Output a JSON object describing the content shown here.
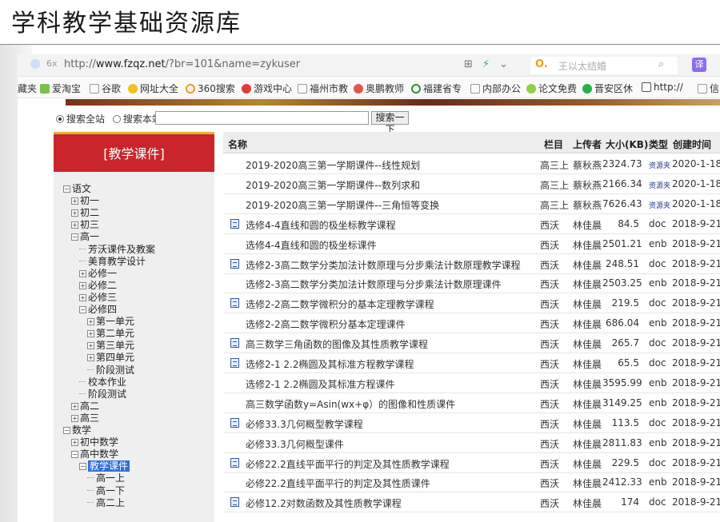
{
  "slide_title": "学科教学基础资源库",
  "browser": {
    "url_prefix": "http://",
    "url_host": "www.fzqz.net",
    "url_path": "/?br=101&name=zykuser",
    "search_placeholder": "王以太结婚",
    "search_engine_glyph": "O.",
    "translate_label": "译",
    "bookmarks": [
      "藏夹",
      "爱淘宝",
      "谷歌",
      "网址大全",
      "360搜索",
      "游戏中心",
      "福州市教",
      "奥鹏教师",
      "福建省专",
      "内部办公",
      "论文免费",
      "晋安区休",
      "http://",
      "信"
    ]
  },
  "site_search": {
    "option_all": "搜索全站",
    "option_site": "搜索本站",
    "button": "搜索一下"
  },
  "sidebar": {
    "header": "[教学课件]",
    "tree": [
      {
        "label": "语文",
        "toggle": "⊟"
      },
      {
        "label": "初一",
        "toggle": "⊞"
      },
      {
        "label": "初二",
        "toggle": "⊞"
      },
      {
        "label": "初三",
        "toggle": "⊞"
      },
      {
        "label": "高一",
        "toggle": "⊟"
      },
      {
        "label": "芳沃课件及教案",
        "toggle": ""
      },
      {
        "label": "美育教学设计",
        "toggle": ""
      },
      {
        "label": "必修一",
        "toggle": "⊞"
      },
      {
        "label": "必修二",
        "toggle": "⊞"
      },
      {
        "label": "必修三",
        "toggle": "⊞"
      },
      {
        "label": "必修四",
        "toggle": "⊟"
      },
      {
        "label": "第一单元",
        "toggle": "⊞"
      },
      {
        "label": "第二单元",
        "toggle": "⊞"
      },
      {
        "label": "第三单元",
        "toggle": "⊞"
      },
      {
        "label": "第四单元",
        "toggle": "⊞"
      },
      {
        "label": "阶段测试",
        "toggle": ""
      },
      {
        "label": "校本作业",
        "toggle": ""
      },
      {
        "label": "阶段测试",
        "toggle": ""
      },
      {
        "label": "高二",
        "toggle": "⊞"
      },
      {
        "label": "高三",
        "toggle": "⊞"
      },
      {
        "label": "数学",
        "toggle": "⊟"
      },
      {
        "label": "初中数学",
        "toggle": "⊞"
      },
      {
        "label": "高中数学",
        "toggle": "⊟"
      },
      {
        "label": "教学课件",
        "toggle": "⊟"
      },
      {
        "label": "高一上",
        "toggle": ""
      },
      {
        "label": "高一下",
        "toggle": ""
      },
      {
        "label": "高二上",
        "toggle": ""
      }
    ]
  },
  "table": {
    "headers": [
      "名称",
      "栏目",
      "上传者",
      "大小(KB)",
      "类型",
      "创建时间"
    ],
    "rows": [
      {
        "name": "2019-2020高三第一学期课件--线性规划",
        "col": "高三上",
        "up": "蔡秋燕",
        "size": "2324.73",
        "type": "资源夹",
        "date": "2020-1-18",
        "icon": false
      },
      {
        "name": "2019-2020高三第一学期课件--数列求和",
        "col": "高三上",
        "up": "蔡秋燕",
        "size": "2166.34",
        "type": "资源夹",
        "date": "2020-1-18",
        "icon": false
      },
      {
        "name": "2019-2020高三第一学期课件--三角恒等变换",
        "col": "高三上",
        "up": "蔡秋燕",
        "size": "7626.43",
        "type": "资源夹",
        "date": "2020-1-18",
        "icon": false
      },
      {
        "name": "选修4-4直线和圆的极坐标教学课程",
        "col": "西沃",
        "up": "林佳晨",
        "size": "84.5",
        "type": "doc",
        "date": "2018-9-21",
        "icon": true
      },
      {
        "name": "选修4-4直线和圆的极坐标课件",
        "col": "西沃",
        "up": "林佳晨",
        "size": "2501.21",
        "type": "enb",
        "date": "2018-9-21",
        "icon": false
      },
      {
        "name": "选修2-3高二数学分类加法计数原理与分步乘法计数原理教学课程",
        "col": "西沃",
        "up": "林佳晨",
        "size": "248.51",
        "type": "doc",
        "date": "2018-9-21",
        "icon": true
      },
      {
        "name": "选修2-3高二数学分类加法计数原理与分步乘法计数原理课件",
        "col": "西沃",
        "up": "林佳晨",
        "size": "2503.25",
        "type": "enb",
        "date": "2018-9-21",
        "icon": false
      },
      {
        "name": "选修2-2高二数学微积分的基本定理教学课程",
        "col": "西沃",
        "up": "林佳晨",
        "size": "219.5",
        "type": "doc",
        "date": "2018-9-21",
        "icon": true
      },
      {
        "name": "选修2-2高二数学微积分基本定理课件",
        "col": "西沃",
        "up": "林佳晨",
        "size": "686.04",
        "type": "enb",
        "date": "2018-9-21",
        "icon": false
      },
      {
        "name": "高三数学三角函数的图像及其性质教学课程",
        "col": "西沃",
        "up": "林佳晨",
        "size": "265.7",
        "type": "doc",
        "date": "2018-9-21",
        "icon": true
      },
      {
        "name": "选修2-1 2.2椭圆及其标准方程教学课程",
        "col": "西沃",
        "up": "林佳晨",
        "size": "65.5",
        "type": "doc",
        "date": "2018-9-21",
        "icon": true
      },
      {
        "name": "选修2-1 2.2椭圆及其标准方程课件",
        "col": "西沃",
        "up": "林佳晨",
        "size": "3595.99",
        "type": "enb",
        "date": "2018-9-21",
        "icon": false
      },
      {
        "name": "高三数学函数y=Asin(wx+φ）的图像和性质课件",
        "col": "西沃",
        "up": "林佳晨",
        "size": "3149.25",
        "type": "enb",
        "date": "2018-9-21",
        "icon": false
      },
      {
        "name": "必修33.3几何概型教学课程",
        "col": "西沃",
        "up": "林佳晨",
        "size": "113.5",
        "type": "doc",
        "date": "2018-9-21",
        "icon": true
      },
      {
        "name": "必修33.3几何概型课件",
        "col": "西沃",
        "up": "林佳晨",
        "size": "2811.83",
        "type": "enb",
        "date": "2018-9-21",
        "icon": false
      },
      {
        "name": "必修22.2直线平面平行的判定及其性质教学课程",
        "col": "西沃",
        "up": "林佳晨",
        "size": "229.5",
        "type": "doc",
        "date": "2018-9-21",
        "icon": true
      },
      {
        "name": "必修22.2直线平面平行的判定及其性质课件",
        "col": "西沃",
        "up": "林佳晨",
        "size": "2412.33",
        "type": "enb",
        "date": "2018-9-21",
        "icon": false
      },
      {
        "name": "必修12.2对数函数及其性质教学课程",
        "col": "西沃",
        "up": "林佳晨",
        "size": "174",
        "type": "doc",
        "date": "2018-9-21",
        "icon": true
      }
    ]
  },
  "colors": {
    "sidebar_header_bg": "#c9252b",
    "sidebar_header_border": "#e8b02c",
    "tree_selected_bg": "#2f6fd6",
    "folder_type_text": "#2a3c8a"
  }
}
